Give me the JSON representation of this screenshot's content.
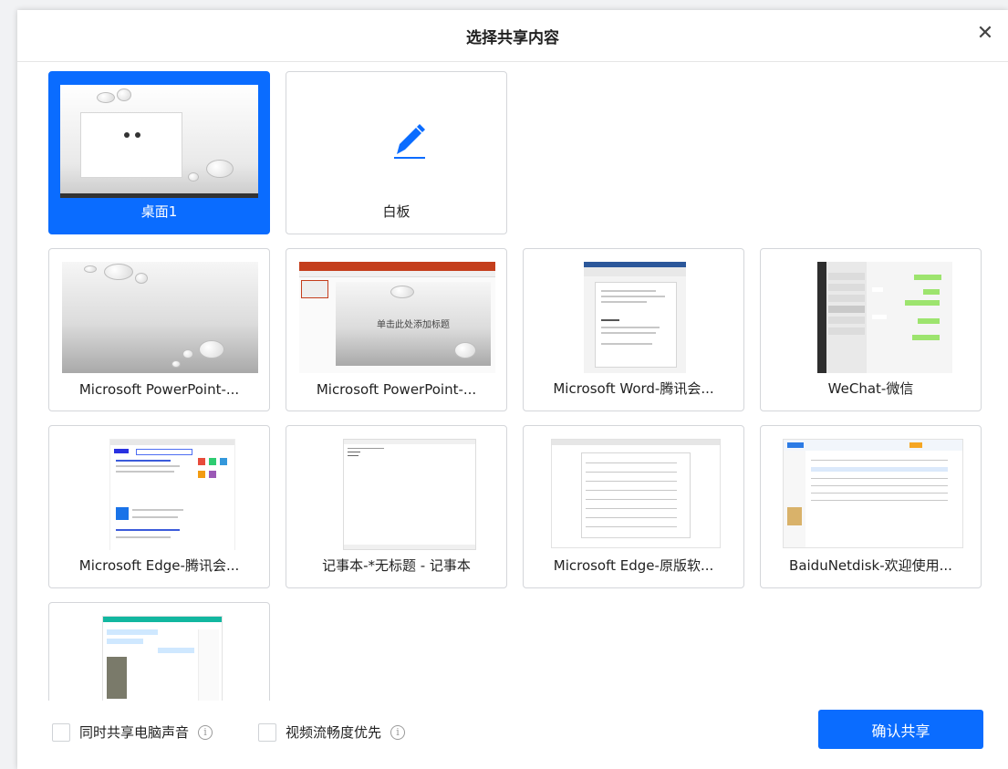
{
  "dialog": {
    "title": "选择共享内容",
    "close_icon": "close-icon"
  },
  "items": [
    {
      "label": "桌面1",
      "selected": true,
      "thumb": "desktop"
    },
    {
      "label": "白板",
      "selected": false,
      "thumb": "whiteboard",
      "icon": "pencil-icon"
    },
    {
      "label": "Microsoft PowerPoint-...",
      "selected": false,
      "thumb": "ppt-slideshow"
    },
    {
      "label": "Microsoft PowerPoint-...",
      "selected": false,
      "thumb": "ppt-editor"
    },
    {
      "label": "Microsoft Word-腾讯会...",
      "selected": false,
      "thumb": "word"
    },
    {
      "label": "WeChat-微信",
      "selected": false,
      "thumb": "wechat"
    },
    {
      "label": "Microsoft Edge-腾讯会...",
      "selected": false,
      "thumb": "edge-search"
    },
    {
      "label": "记事本-*无标题 - 记事本",
      "selected": false,
      "thumb": "notepad"
    },
    {
      "label": "Microsoft Edge-原版软...",
      "selected": false,
      "thumb": "edge-list"
    },
    {
      "label": "BaiduNetdisk-欢迎使用...",
      "selected": false,
      "thumb": "netdisk"
    },
    {
      "label": "",
      "selected": false,
      "thumb": "chat-window"
    }
  ],
  "ppt_slide_title": "单击此处添加标题",
  "options": {
    "share_audio": {
      "label": "同时共享电脑声音",
      "checked": false
    },
    "video_smooth": {
      "label": "视频流畅度优先",
      "checked": false
    },
    "info_icon": "info-icon"
  },
  "confirm_button": "确认共享",
  "colors": {
    "accent": "#0a6cff",
    "card_border": "#d4d6da"
  }
}
